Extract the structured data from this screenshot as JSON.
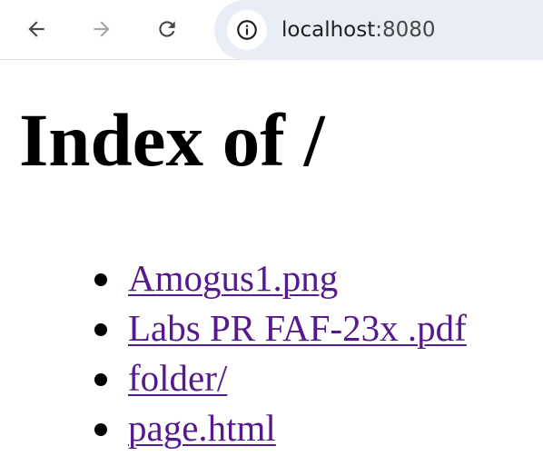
{
  "browser": {
    "url_host": "localhost",
    "url_port": ":8080",
    "icons": {
      "back": "arrow-left-icon",
      "forward": "arrow-right-icon",
      "reload": "reload-icon",
      "site_info": "info-icon"
    },
    "forward_enabled": false
  },
  "page": {
    "heading": "Index of /",
    "entries": [
      {
        "name": "Amogus1.png"
      },
      {
        "name": "Labs PR FAF-23x .pdf"
      },
      {
        "name": "folder/"
      },
      {
        "name": "page.html"
      }
    ]
  },
  "colors": {
    "link_visited": "#551a8b",
    "omnibox_bg": "#e9eef6",
    "icon_active": "#474747",
    "icon_disabled": "#a8a8a8"
  }
}
